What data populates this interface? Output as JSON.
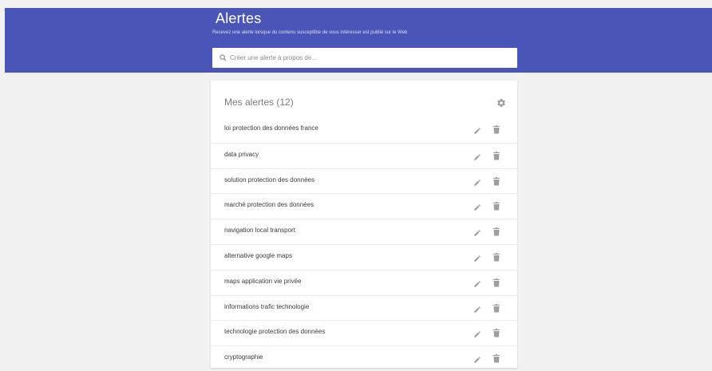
{
  "header": {
    "title": "Alertes",
    "subtitle": "Recevez une alerte lorsque du contenu susceptible de vous intéresser est publié sur le Web",
    "bg_color": "#4a56b7"
  },
  "search": {
    "placeholder": "Créer une alerte à propos de..."
  },
  "alerts": {
    "title": "Mes alertes (12)",
    "items": [
      {
        "label": "loi protection des données france"
      },
      {
        "label": "data privacy"
      },
      {
        "label": "solution protection des données"
      },
      {
        "label": "marché protection des données"
      },
      {
        "label": "navigation local transport"
      },
      {
        "label": "alternative google maps"
      },
      {
        "label": "maps application vie privée"
      },
      {
        "label": "informations trafic technologie"
      },
      {
        "label": "technologie protection des données"
      },
      {
        "label": "cryptographie"
      }
    ]
  },
  "icons": {
    "search": "search-icon",
    "settings": "gear-icon",
    "edit": "pencil-icon",
    "delete": "trash-icon"
  }
}
